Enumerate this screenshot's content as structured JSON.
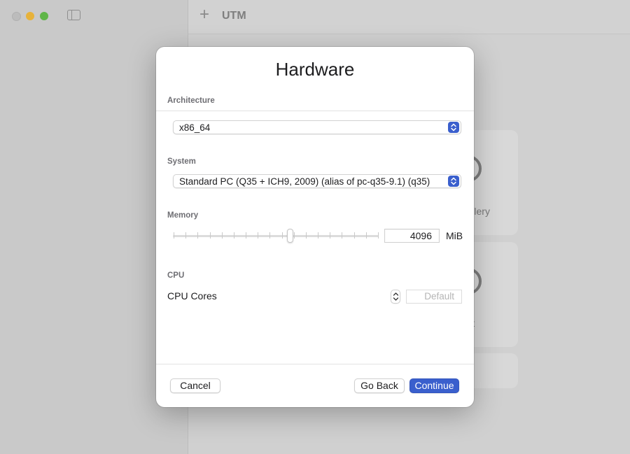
{
  "window": {
    "app_title": "UTM",
    "colors": {
      "close": "#bcbcbc",
      "minimize": "#e7b23a",
      "maximize": "#5fb548"
    }
  },
  "background_cards": {
    "gallery_text": "M Gallery",
    "import_text": "ort"
  },
  "dialog": {
    "title": "Hardware",
    "architecture": {
      "label": "Architecture",
      "selected": "x86_64"
    },
    "system": {
      "label": "System",
      "selected": "Standard PC (Q35 + ICH9, 2009) (alias of pc-q35-9.1) (q35)"
    },
    "memory": {
      "label": "Memory",
      "value": "4096",
      "unit": "MiB",
      "slider_fraction": 0.57
    },
    "cpu": {
      "label": "CPU",
      "cores_label": "CPU Cores",
      "cores_placeholder": "Default"
    },
    "buttons": {
      "cancel": "Cancel",
      "go_back": "Go Back",
      "continue": "Continue"
    },
    "accent_color": "#3a5fcd"
  }
}
